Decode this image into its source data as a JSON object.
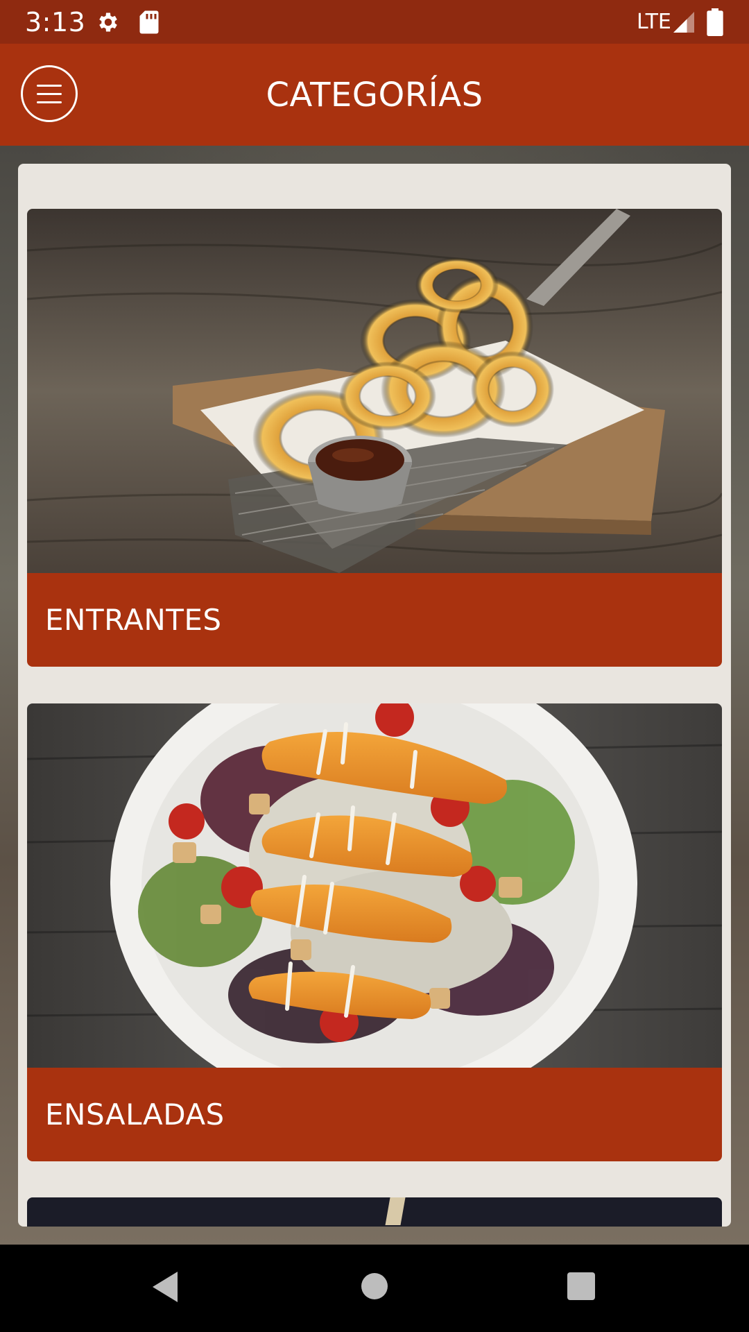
{
  "status_bar": {
    "time": "3:13",
    "network": "LTE",
    "icons": [
      "settings-icon",
      "sd-card-icon",
      "signal-icon",
      "battery-icon"
    ]
  },
  "app_bar": {
    "title": "CATEGORÍAS",
    "menu_icon": "hamburger-menu-icon"
  },
  "categories": [
    {
      "label": "ENTRANTES",
      "image": "onion-rings-basket-photo"
    },
    {
      "label": "ENSALADAS",
      "image": "crispy-chicken-salad-photo"
    },
    {
      "label": "",
      "image": "dark-partial-photo"
    }
  ],
  "nav_bar": {
    "buttons": [
      "back-icon",
      "home-icon",
      "recents-icon"
    ]
  },
  "colors": {
    "status_bar": "#8f2a10",
    "accent": "#a9320f",
    "panel": "#e9e5df"
  }
}
